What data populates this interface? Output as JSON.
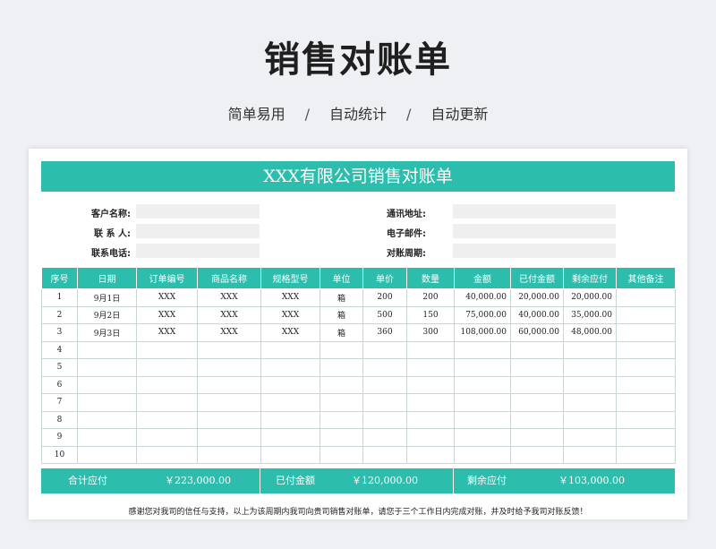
{
  "page": {
    "title": "销售对账单",
    "features": [
      "简单易用",
      "自动统计",
      "自动更新"
    ],
    "separator": "/"
  },
  "document": {
    "header": "XXX有限公司销售对账单",
    "info": {
      "customer_label": "客户名称:",
      "contact_label": "联 系 人:",
      "phone_label": "联系电话:",
      "address_label": "通讯地址:",
      "email_label": "电子邮件:",
      "period_label": "对账周期:",
      "customer_value": "",
      "contact_value": "",
      "phone_value": "",
      "address_value": "",
      "email_value": "",
      "period_value": ""
    },
    "table": {
      "headers": [
        "序号",
        "日期",
        "订单编号",
        "商品名称",
        "规格型号",
        "单位",
        "单价",
        "数量",
        "金额",
        "已付金额",
        "剩余应付",
        "其他备注"
      ],
      "rows": [
        [
          "1",
          "9月1日",
          "XXX",
          "XXX",
          "XXX",
          "箱",
          "200",
          "200",
          "40,000.00",
          "20,000.00",
          "20,000.00",
          ""
        ],
        [
          "2",
          "9月2日",
          "XXX",
          "XXX",
          "XXX",
          "箱",
          "500",
          "150",
          "75,000.00",
          "40,000.00",
          "35,000.00",
          ""
        ],
        [
          "3",
          "9月3日",
          "XXX",
          "XXX",
          "XXX",
          "箱",
          "360",
          "300",
          "108,000.00",
          "60,000.00",
          "48,000.00",
          ""
        ],
        [
          "4",
          "",
          "",
          "",
          "",
          "",
          "",
          "",
          "",
          "",
          "",
          ""
        ],
        [
          "5",
          "",
          "",
          "",
          "",
          "",
          "",
          "",
          "",
          "",
          "",
          ""
        ],
        [
          "6",
          "",
          "",
          "",
          "",
          "",
          "",
          "",
          "",
          "",
          "",
          ""
        ],
        [
          "7",
          "",
          "",
          "",
          "",
          "",
          "",
          "",
          "",
          "",
          "",
          ""
        ],
        [
          "8",
          "",
          "",
          "",
          "",
          "",
          "",
          "",
          "",
          "",
          "",
          ""
        ],
        [
          "9",
          "",
          "",
          "",
          "",
          "",
          "",
          "",
          "",
          "",
          "",
          ""
        ],
        [
          "10",
          "",
          "",
          "",
          "",
          "",
          "",
          "",
          "",
          "",
          "",
          ""
        ]
      ]
    },
    "summary": {
      "total_label": "合计应付",
      "total_value": "￥223,000.00",
      "paid_label": "已付金额",
      "paid_value": "￥120,000.00",
      "remaining_label": "剩余应付",
      "remaining_value": "￥103,000.00"
    },
    "footnote": "感谢您对我司的信任与支持，以上为该周期内我司向贵司销售对账单，请您于三个工作日内完成对账，并及时给予我司对账反馈！"
  },
  "colors": {
    "accent": "#2dbdad",
    "background": "#eef0f3",
    "field": "#efefef"
  }
}
